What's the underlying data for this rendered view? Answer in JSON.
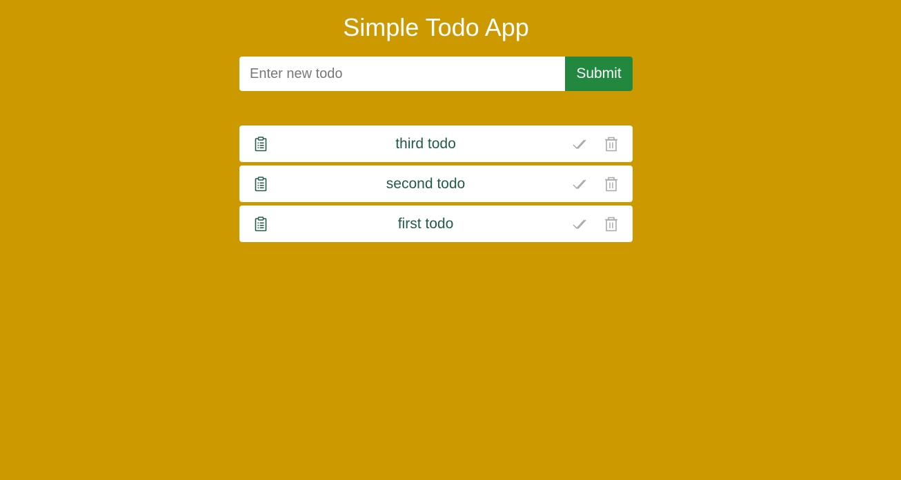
{
  "header": {
    "title": "Simple Todo App"
  },
  "form": {
    "input_placeholder": "Enter new todo",
    "input_value": "",
    "submit_label": "Submit"
  },
  "todos": [
    {
      "text": "third todo",
      "icon": "clipboard-icon"
    },
    {
      "text": "second todo",
      "icon": "clipboard-icon"
    },
    {
      "text": "first todo",
      "icon": "clipboard-icon"
    }
  ],
  "colors": {
    "background": "#cc9900",
    "submit_button": "#22873f",
    "todo_text": "#225c42",
    "action_icons": "#aaaaaa"
  }
}
